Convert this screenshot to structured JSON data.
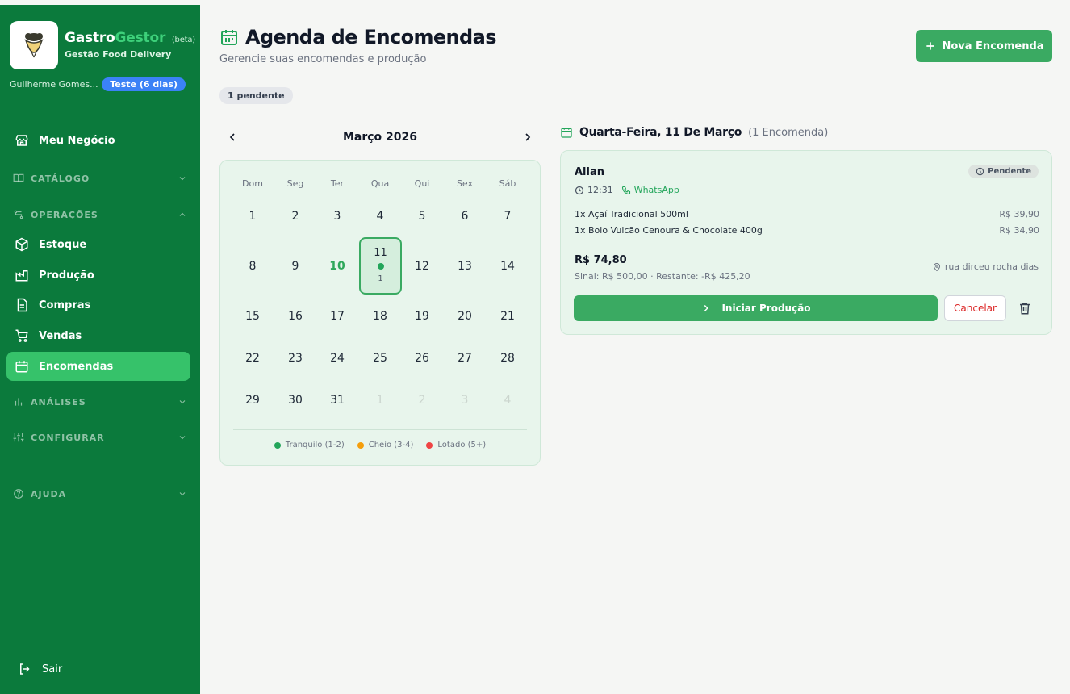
{
  "sidebar": {
    "brand_part1": "Gastro",
    "brand_part2": "Gestor",
    "brand_beta": "(beta)",
    "brand_subtitle": "Gestão Food Delivery",
    "user_name": "Guilherme Gomes...",
    "trial_badge": "Teste (6 dias)",
    "nav": {
      "meu_negocio": "Meu Negócio",
      "catalogo": "CATÁLOGO",
      "operacoes": "OPERAÇÕES",
      "estoque": "Estoque",
      "producao": "Produção",
      "compras": "Compras",
      "vendas": "Vendas",
      "encomendas": "Encomendas",
      "analises": "ANÁLISES",
      "configurar": "CONFIGURAR",
      "ajuda": "AJUDA"
    },
    "logout": "Sair",
    "colors": {
      "background": "#0b7a3c",
      "active": "#36c26a",
      "trial": "#3b82f6"
    }
  },
  "header": {
    "title": "Agenda de Encomendas",
    "subtitle": "Gerencie suas encomendas e produção",
    "new_button": "Nova Encomenda",
    "pending_chip": "1 pendente"
  },
  "calendar": {
    "month": "Março 2026",
    "weekdays": [
      "Dom",
      "Seg",
      "Ter",
      "Qua",
      "Qui",
      "Sex",
      "Sáb"
    ],
    "weeks": [
      [
        "1",
        "2",
        "3",
        "4",
        "5",
        "6",
        "7"
      ],
      [
        "8",
        "9",
        "10",
        "11",
        "12",
        "13",
        "14"
      ],
      [
        "15",
        "16",
        "17",
        "18",
        "19",
        "20",
        "21"
      ],
      [
        "22",
        "23",
        "24",
        "25",
        "26",
        "27",
        "28"
      ],
      [
        "29",
        "30",
        "31",
        "1",
        "2",
        "3",
        "4"
      ]
    ],
    "today": "10",
    "selected_day": "11",
    "selected_count": "1",
    "legend": [
      {
        "label": "Tranquilo (1-2)",
        "color": "#22a55a"
      },
      {
        "label": "Cheio (3-4)",
        "color": "#f59e0b"
      },
      {
        "label": "Lotado (5+)",
        "color": "#ef4444"
      }
    ]
  },
  "day_detail": {
    "title": "Quarta-Feira, 11 De Março",
    "count": "(1 Encomenda)"
  },
  "order": {
    "customer": "Allan",
    "status": "Pendente",
    "time": "12:31",
    "channel": "WhatsApp",
    "items": [
      {
        "desc": "1x Açaí Tradicional 500ml",
        "price": "R$ 39,90"
      },
      {
        "desc": "1x Bolo Vulcão Cenoura & Chocolate 400g",
        "price": "R$ 34,90"
      }
    ],
    "total": "R$ 74,80",
    "deposit_line": "Sinal: R$ 500,00 · Restante: -R$ 425,20",
    "address": "rua dirceu rocha dias",
    "start_button": "Iniciar Produção",
    "cancel_button": "Cancelar"
  }
}
